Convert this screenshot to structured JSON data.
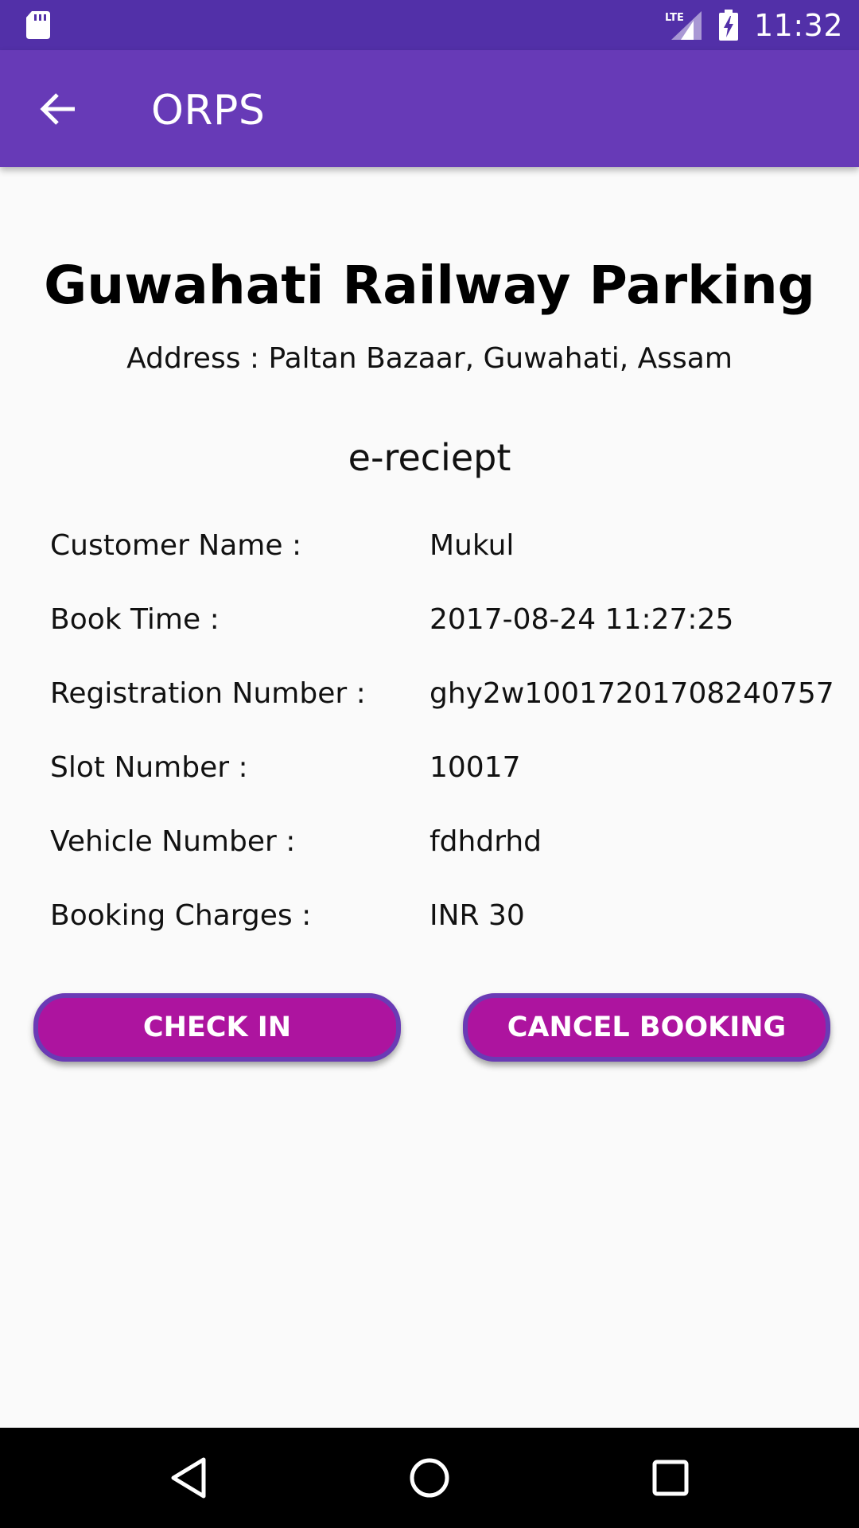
{
  "status_bar": {
    "time": "11:32",
    "network_label": "LTE",
    "icons": [
      "sd-card-icon",
      "lte-signal-icon",
      "battery-charging-icon"
    ]
  },
  "app_bar": {
    "title": "ORPS",
    "back_icon": "arrow-back-icon"
  },
  "parking": {
    "name": "Guwahati Railway Parking",
    "address": "Address : Paltan Bazaar, Guwahati, Assam"
  },
  "receipt": {
    "heading": "e-reciept",
    "rows": [
      {
        "label": "Customer Name :",
        "value": "Mukul"
      },
      {
        "label": "Book Time :",
        "value": "2017-08-24 11:27:25"
      },
      {
        "label": "Registration Number :",
        "value": "ghy2w10017201708240757"
      },
      {
        "label": "Slot Number :",
        "value": "10017"
      },
      {
        "label": "Vehicle Number :",
        "value": "fdhdrhd"
      },
      {
        "label": "Booking Charges :",
        "value": "INR 30"
      }
    ]
  },
  "buttons": {
    "check_in": "CHECK IN",
    "cancel_booking": "CANCEL BOOKING"
  },
  "colors": {
    "status_bar": "#5230a8",
    "app_bar": "#673ab7",
    "button_fill": "#ad149f",
    "button_border": "#6a3bb5",
    "background": "#fafafa"
  },
  "nav_bar": {
    "icons": [
      "back-triangle-icon",
      "home-circle-icon",
      "recents-square-icon"
    ]
  }
}
